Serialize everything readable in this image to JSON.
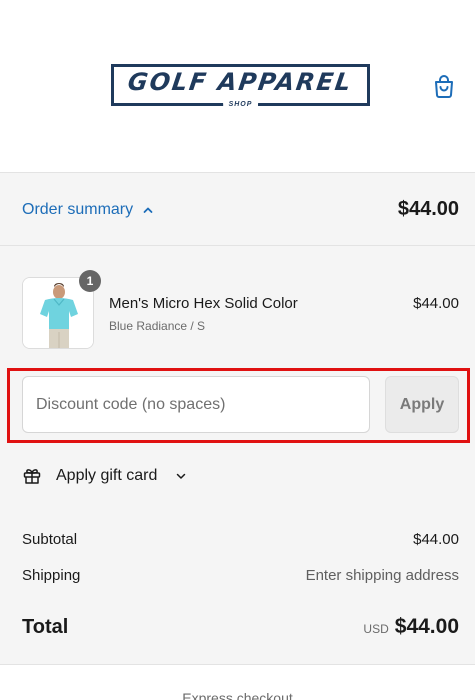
{
  "header": {
    "logo": {
      "text": "GOLF APPAREL",
      "subtext": "SHOP"
    },
    "cart_icon": "shopping-bag-icon"
  },
  "summary_bar": {
    "toggle_label": "Order summary",
    "toggle_icon": "chevron-up-icon",
    "total": "$44.00"
  },
  "line_items": [
    {
      "quantity": "1",
      "name": "Men's Micro Hex Solid Color",
      "variant": "Blue Radiance / S",
      "price": "$44.00",
      "image": "polo-shirt-model"
    }
  ],
  "discount": {
    "placeholder": "Discount code (no spaces)",
    "value": "",
    "apply_label": "Apply",
    "highlight_color": "#e01111"
  },
  "gift_card": {
    "label": "Apply gift card",
    "icon": "gift-icon",
    "chevron": "chevron-down-icon"
  },
  "totals": {
    "subtotal_label": "Subtotal",
    "subtotal_value": "$44.00",
    "shipping_label": "Shipping",
    "shipping_value": "Enter shipping address",
    "total_label": "Total",
    "currency": "USD",
    "total_value": "$44.00"
  },
  "express": {
    "label": "Express checkout"
  },
  "colors": {
    "link": "#1d6db8",
    "brand_navy": "#1f3a5c",
    "summary_bg": "#f5f5f5"
  }
}
